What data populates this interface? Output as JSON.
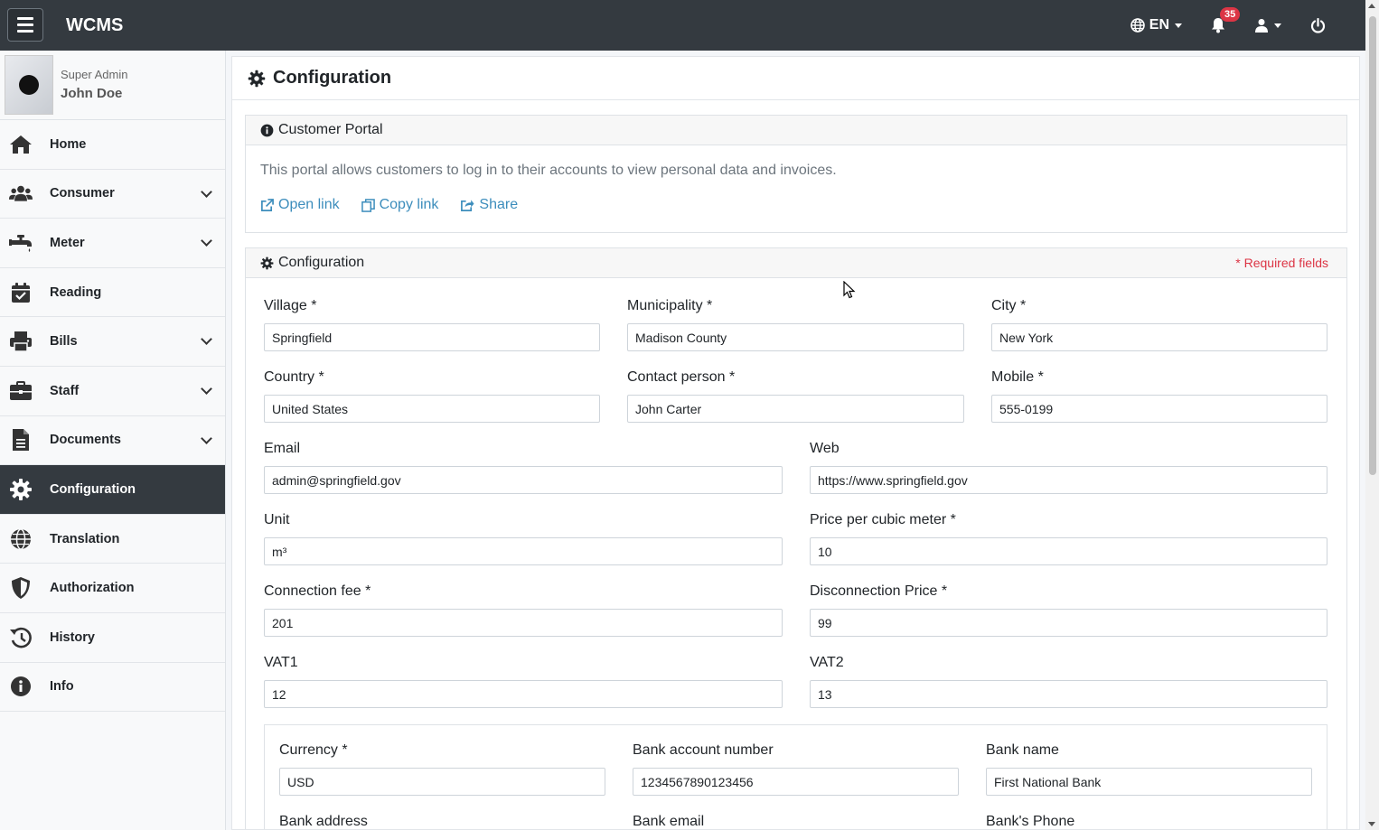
{
  "app": {
    "brand": "WCMS"
  },
  "navbar": {
    "language": "EN",
    "notification_count": "35"
  },
  "user": {
    "role": "Super Admin",
    "name": "John Doe"
  },
  "sidebar": {
    "items": [
      {
        "label": "Home",
        "icon": "home-icon"
      },
      {
        "label": "Consumer",
        "icon": "users-icon"
      },
      {
        "label": "Meter",
        "icon": "faucet-icon"
      },
      {
        "label": "Reading",
        "icon": "calendar-check-icon"
      },
      {
        "label": "Bills",
        "icon": "print-icon"
      },
      {
        "label": "Staff",
        "icon": "briefcase-icon"
      },
      {
        "label": "Documents",
        "icon": "file-icon"
      },
      {
        "label": "Configuration",
        "icon": "gear-icon"
      },
      {
        "label": "Translation",
        "icon": "globe-icon"
      },
      {
        "label": "Authorization",
        "icon": "shield-icon"
      },
      {
        "label": "History",
        "icon": "history-icon"
      },
      {
        "label": "Info",
        "icon": "info-icon"
      }
    ]
  },
  "page": {
    "title": "Configuration"
  },
  "portal": {
    "title": "Customer Portal",
    "description": "This portal allows customers to log in to their accounts to view personal data and invoices.",
    "open_link": "Open link",
    "copy_link": "Copy link",
    "share": "Share"
  },
  "config": {
    "title": "Configuration",
    "required_note": "* Required fields",
    "fields": {
      "village": {
        "label": "Village *",
        "value": "Springfield"
      },
      "municipality": {
        "label": "Municipality *",
        "value": "Madison County"
      },
      "city": {
        "label": "City *",
        "value": "New York"
      },
      "country": {
        "label": "Country *",
        "value": "United States"
      },
      "contact_person": {
        "label": "Contact person *",
        "value": "John Carter"
      },
      "mobile": {
        "label": "Mobile *",
        "value": "555-0199"
      },
      "email": {
        "label": "Email",
        "value": "admin@springfield.gov"
      },
      "web": {
        "label": "Web",
        "value": "https://www.springfield.gov"
      },
      "unit": {
        "label": "Unit",
        "value": "m³"
      },
      "price_per_cubic_meter": {
        "label": "Price per cubic meter *",
        "value": "10"
      },
      "connection_fee": {
        "label": "Connection fee *",
        "value": "201"
      },
      "disconnection_price": {
        "label": "Disconnection Price *",
        "value": "99"
      },
      "vat1": {
        "label": "VAT1",
        "value": "12"
      },
      "vat2": {
        "label": "VAT2",
        "value": "13"
      },
      "currency": {
        "label": "Currency *",
        "value": "USD"
      },
      "bank_account_number": {
        "label": "Bank account number",
        "value": "1234567890123456"
      },
      "bank_name": {
        "label": "Bank name",
        "value": "First National Bank"
      },
      "bank_address": {
        "label": "Bank address"
      },
      "bank_email": {
        "label": "Bank email"
      },
      "bank_phone": {
        "label": "Bank's Phone"
      }
    }
  },
  "colors": {
    "navbar": "#343a40",
    "active_menu": "#343a40",
    "link": "#3c8dbc",
    "required": "#dc3545",
    "badge": "#dc3545"
  }
}
